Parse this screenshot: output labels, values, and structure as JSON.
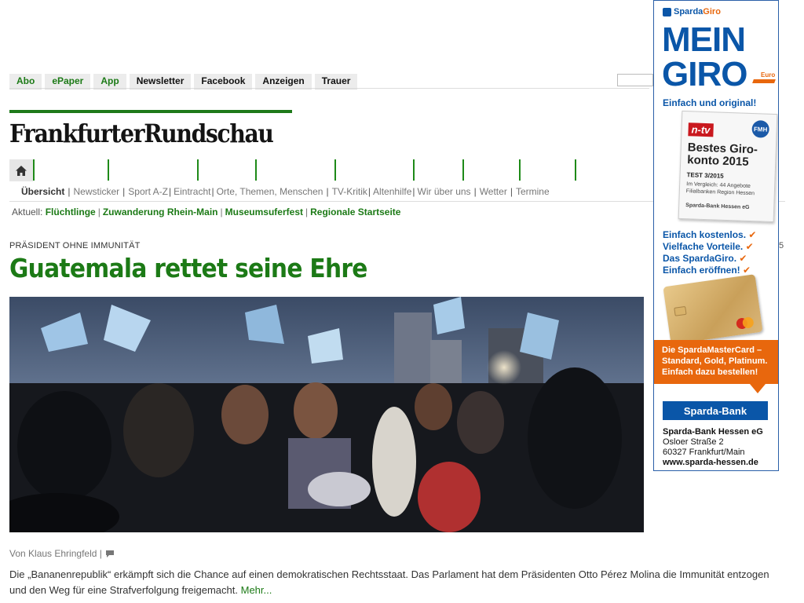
{
  "topnav": [
    {
      "label": "Abo",
      "green": true
    },
    {
      "label": "ePaper",
      "green": true
    },
    {
      "label": "App",
      "green": true
    },
    {
      "label": "Newsletter",
      "green": false
    },
    {
      "label": "Facebook",
      "green": false
    },
    {
      "label": "Anzeigen",
      "green": false
    },
    {
      "label": "Trauer",
      "green": false
    }
  ],
  "logo": "FrankfurterRundschau",
  "subnav": [
    "Übersicht",
    "Newsticker",
    "Sport A-Z",
    "Eintracht",
    "Orte, Themen, Menschen",
    "TV-Kritik",
    "Altenhilfe",
    "Wir über uns",
    "Wetter",
    "Termine"
  ],
  "aktuell": {
    "label": "Aktuell:",
    "links": [
      "Flüchtlinge",
      "Zuwanderung Rhein-Main",
      "Museumsuferfest",
      "Regionale Startseite"
    ]
  },
  "article": {
    "kicker": "PRÄSIDENT OHNE IMMUNITÄT",
    "headline": "Guatemala rettet seine Ehre",
    "pagenum": "5",
    "byline": "Von Klaus Ehringfeld |",
    "teaser": "Die „Bananenrepublik“ erkämpft sich die Chance auf einen demokratischen Rechtsstaat. Das Parlament hat dem Präsidenten Otto Pérez Molina die Immunität entzogen und den Weg für eine Strafverfolgung freigemacht.",
    "more": "Mehr..."
  },
  "ad": {
    "brand_a": "Sparda",
    "brand_b": "Giro",
    "big1": "MEIN",
    "big2": "GIRO",
    "euro": "Euro",
    "tagline": "Einfach und original!",
    "ntv": "n-tv",
    "fmh": "FMH",
    "award_title": "Bestes Giro-konto 2015",
    "award_test": "TEST  3/2015",
    "award_note": "Im Vergleich: 44 Angebote Filialbanken Region Hessen",
    "award_bank": "Sparda-Bank Hessen eG",
    "benefits": [
      "Einfach kostenlos.",
      "Vielfache Vorteile.",
      "Das SpardaGiro.",
      "Einfach eröffnen!"
    ],
    "check": "✔",
    "orange": "Die SpardaMasterCard – Standard, Gold, Platinum. Einfach dazu bestellen!",
    "logo": "Sparda-Bank",
    "address": {
      "name": "Sparda-Bank Hessen eG",
      "street": "Osloer Straße 2",
      "city": "60327 Frankfurt/Main",
      "web": "www.sparda-hessen.de"
    }
  },
  "colors": {
    "green": "#1c7a16",
    "blue": "#0a56a8",
    "orange": "#e8670d"
  },
  "icons": {
    "home": "home-icon",
    "comment": "comment-icon"
  }
}
